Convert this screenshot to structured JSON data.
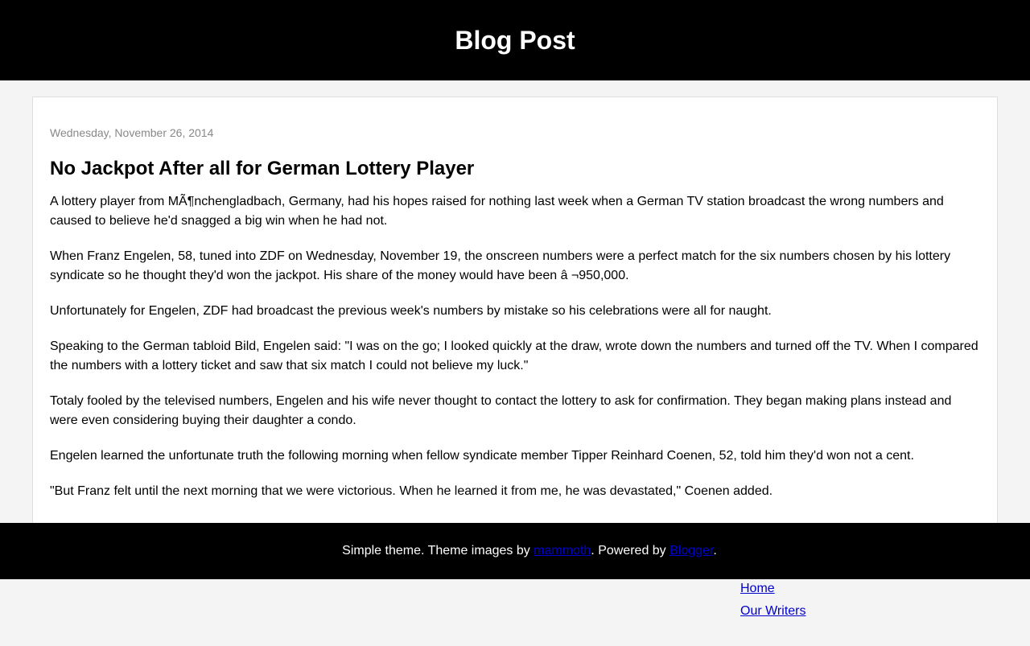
{
  "header": {
    "title": "Blog Post"
  },
  "post": {
    "date": "Wednesday, November 26, 2014",
    "title": "No Jackpot After all for German Lottery Player",
    "paragraphs": [
      "A lottery player from MÃ¶nchengladbach, Germany, had his hopes raised for nothing last week when a German TV station broadcast the wrong numbers and caused to believe he'd snagged a big win when he had not.",
      "When Franz Engelen, 58, tuned into ZDF on Wednesday, November 19, the onscreen numbers were a perfect match for the six numbers chosen by his lottery syndicate so he thought they'd won the jackpot. His share of the money would have been â   ¬950,000.",
      "Unfortunately for Engelen, ZDF had broadcast the previous week's numbers by mistake so his celebrations were all for naught.",
      "Speaking to the German tabloid Bild, Engelen said: \"I was on the go; I looked quickly at the draw, wrote down the numbers and turned off the TV. When I compared the numbers with a lottery ticket and saw that six match I could not believe my luck.\"",
      "Totaly fooled by the televised numbers, Engelen and his wife never thought to contact the lottery to ask for confirmation. They began making plans instead and were even considering buying their daughter a condo.",
      "Engelen learned the unfortunate truth the following morning when fellow syndicate member Tipper Reinhard Coenen, 52, told him they'd won not a cent.",
      "\"But Franz felt until the next morning that we were victorious. When he learned it from me, he was devastated,\" Coenen added."
    ]
  },
  "footer": {
    "text_before": "Simple theme. Theme images by ",
    "link1": "mammoth",
    "text_middle": ". Powered by ",
    "link2": "Blogger",
    "text_after": "."
  },
  "pages": {
    "home": "Home",
    "writers": "Our Writers"
  },
  "colors": {
    "header_bg": "#000000",
    "page_bg": "#f4f4f4",
    "link": "#0000cc",
    "date_text": "#888888"
  }
}
